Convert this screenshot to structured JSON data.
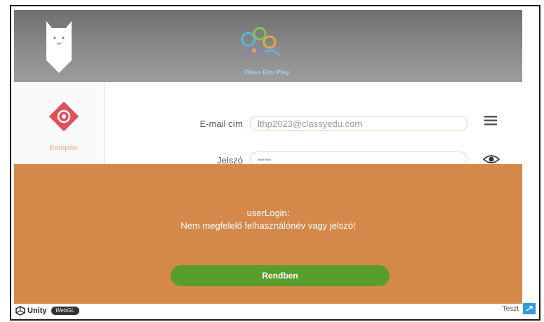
{
  "banner": {
    "brand_text": "Class Edu Play"
  },
  "login_panel": {
    "label": "Belépés"
  },
  "form": {
    "email_label": "E-mail cím",
    "email_value": "lthp2023@classyedu.com",
    "password_label": "Jelszó",
    "password_value": "••••••"
  },
  "alert": {
    "title": "userLogin:",
    "message": "Nem megfelelő felhasználónév vagy jelszó!",
    "ok_label": "Rendben"
  },
  "footer": {
    "unity_text": "Unity",
    "webgl_text": "WebGL",
    "title": "Teszt"
  },
  "colors": {
    "alert_bg": "#d4894a",
    "button_green": "#5a9d2f",
    "login_icon": "#e0505a"
  }
}
